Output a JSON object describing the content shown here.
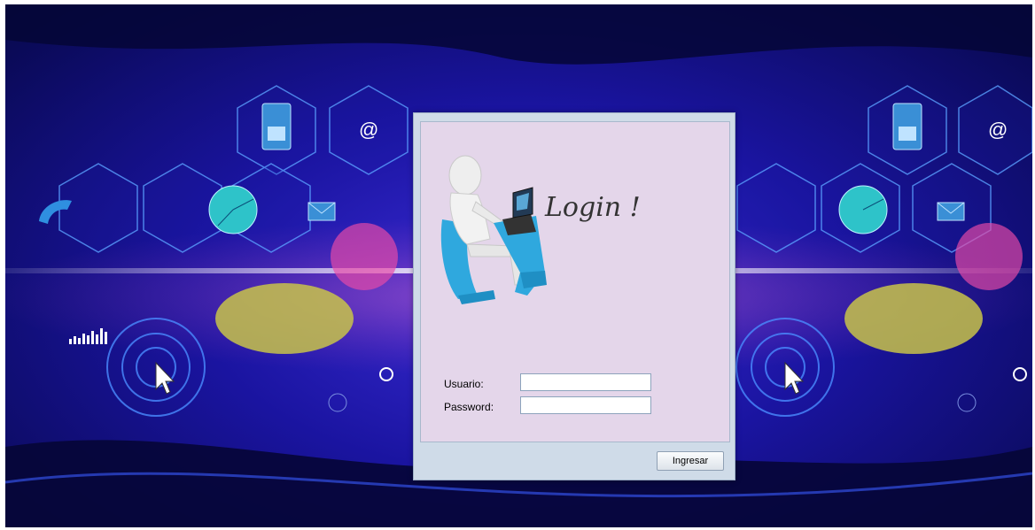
{
  "background": {
    "icons": [
      "phone-icon",
      "tablet-icon",
      "at-icon",
      "mail-icon",
      "pie-chart-icon",
      "cursor-icon",
      "target-icon",
      "bar-chart-icon",
      "copyright-icon"
    ],
    "accent_colors": [
      "#1a14a0",
      "#07084a",
      "#3a8fd6",
      "#e94aa8",
      "#c9c44a"
    ]
  },
  "dialog": {
    "illustration": {
      "handwritten_text": "Login !",
      "icon": "person-at-laptop-icon"
    },
    "form": {
      "usuario_label": "Usuario:",
      "usuario_value": "",
      "password_label": "Password:",
      "password_value": ""
    },
    "buttons": {
      "ingresar_label": "Ingresar"
    }
  }
}
